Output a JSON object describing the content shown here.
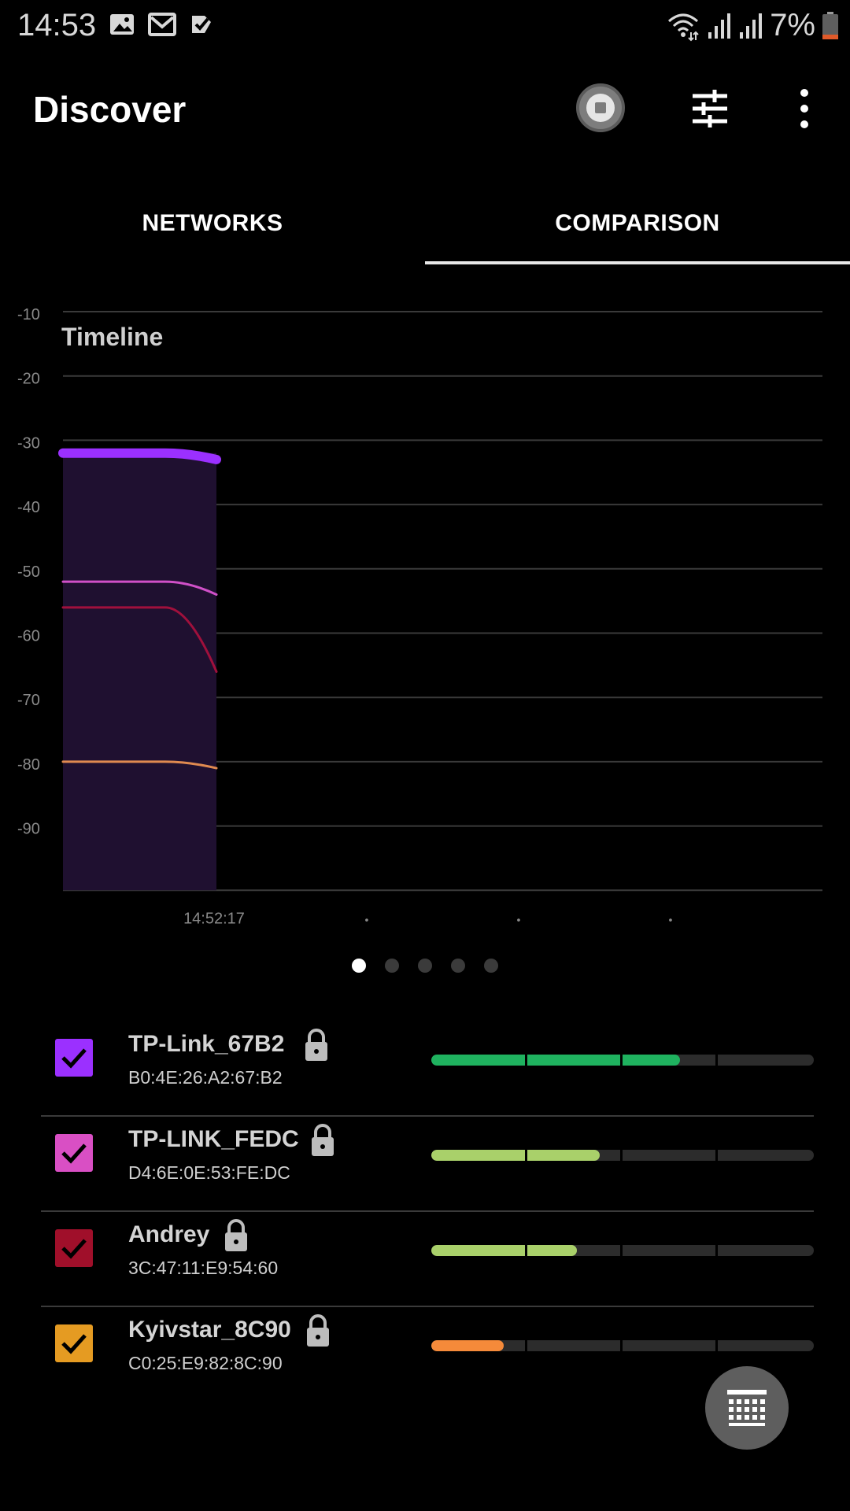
{
  "status_bar": {
    "time": "14:53",
    "battery": "7%"
  },
  "app_bar": {
    "title": "Discover"
  },
  "tabs": [
    {
      "label": "NETWORKS",
      "selected": false
    },
    {
      "label": "COMPARISON",
      "selected": true
    }
  ],
  "chart_data": {
    "type": "line",
    "title": "Timeline",
    "ylabel": "",
    "y_ticks": [
      "-10",
      "-20",
      "-30",
      "-40",
      "-50",
      "-60",
      "-70",
      "-80",
      "-90"
    ],
    "ylim": [
      -100,
      -10
    ],
    "x_ticks": [
      "14:52:17",
      "•",
      "•",
      "•"
    ],
    "series": [
      {
        "color": "#9b30ff",
        "values": [
          -32,
          -32,
          -33
        ]
      },
      {
        "color": "#d050c8",
        "values": [
          -52,
          -52,
          -54
        ]
      },
      {
        "color": "#a0103c",
        "values": [
          -56,
          -56,
          -66
        ]
      },
      {
        "color": "#e08a50",
        "values": [
          -80,
          -80,
          -81
        ]
      }
    ]
  },
  "page_indicator": {
    "count": 5,
    "active": 0
  },
  "networks": [
    {
      "name": "TP-Link_67B2",
      "mac": "B0:4E:26:A2:67:B2",
      "color": "#9b30ff",
      "checked": true,
      "signal": 0.65,
      "signal_color": "#1fb25f"
    },
    {
      "name": "TP-LINK_FEDC",
      "mac": "D4:6E:0E:53:FE:DC",
      "color": "#d94fc4",
      "checked": true,
      "signal": 0.44,
      "signal_color": "#a9d06a"
    },
    {
      "name": "Andrey",
      "mac": "3C:47:11:E9:54:60",
      "color": "#a00f2a",
      "checked": true,
      "signal": 0.38,
      "signal_color": "#a9d06a"
    },
    {
      "name": "Kyivstar_8C90",
      "mac": "C0:25:E9:82:8C:90",
      "color": "#e59b22",
      "checked": true,
      "signal": 0.19,
      "signal_color": "#f58a3a"
    }
  ],
  "icons": {
    "status_left": [
      "image-icon",
      "mail-icon",
      "check-icon"
    ],
    "status_right": [
      "wifi-icon",
      "signal-icon",
      "signal-icon",
      "battery-icon"
    ],
    "app_bar": [
      "record-stop-icon",
      "filter-icon",
      "more-vert-icon"
    ],
    "fab": "keypad-icon"
  }
}
